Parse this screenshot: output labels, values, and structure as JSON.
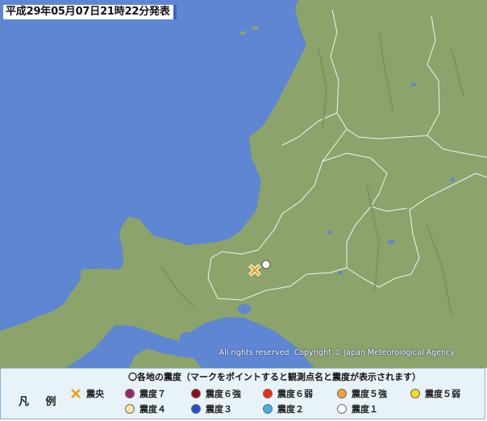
{
  "header": {
    "timestamp": "平成29年05月07日21時22分発表"
  },
  "map": {
    "copyright": "All rights reserved. Copyright © Japan Meteorological Agency",
    "colors": {
      "sea": "#5e86d2",
      "land": "#8ca36b",
      "lake": "#5e86d2",
      "boundary": "#f4f4f4",
      "epicenter_mark": "#f39c12"
    },
    "markers": {
      "epicenter": {
        "icon": "cross-icon"
      },
      "observation_point": {
        "icon": "white-circle-icon",
        "intensity": "震度1"
      }
    }
  },
  "legend": {
    "title": "凡 例",
    "heading": "〇各地の震度（マークをポイントすると観測点名と震度が表示されます）",
    "epicenter": {
      "label": "震央",
      "icon": "cross-icon",
      "color": "#f39c12"
    },
    "intensities": [
      {
        "label": "震度７",
        "color": "#a1206f"
      },
      {
        "label": "震度６強",
        "color": "#8e0b18"
      },
      {
        "label": "震度６弱",
        "color": "#f02b16"
      },
      {
        "label": "震度５強",
        "color": "#f5a133"
      },
      {
        "label": "震度５弱",
        "color": "#f3de19"
      },
      {
        "label": "震度４",
        "color": "#f8e5a6"
      },
      {
        "label": "震度３",
        "color": "#2052cf"
      },
      {
        "label": "震度２",
        "color": "#3fb1e2"
      },
      {
        "label": "震度１",
        "color": "#ffffff"
      }
    ]
  }
}
